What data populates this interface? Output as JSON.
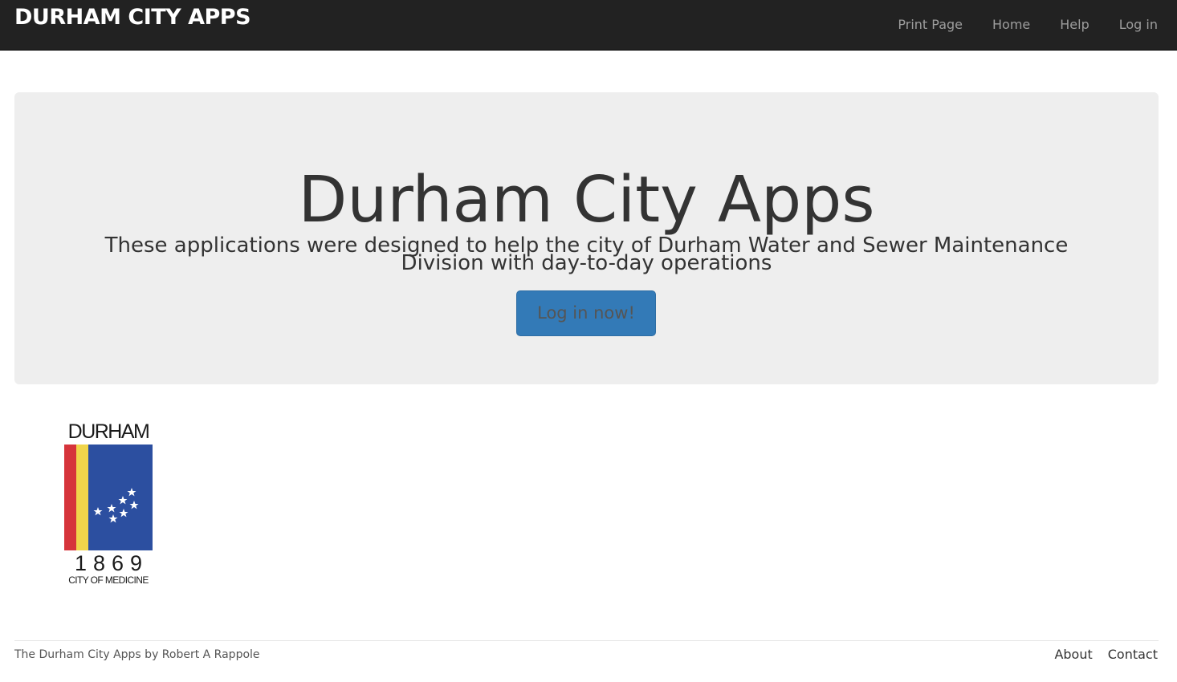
{
  "navbar": {
    "brand": "DURHAM CITY APPS",
    "links": [
      "Print Page",
      "Home",
      "Help",
      "Log in"
    ]
  },
  "jumbotron": {
    "title": "Durham City Apps",
    "lead": "These applications were designed to help the city of Durham Water and Sewer Maintenance Division with day-to-day operations",
    "button_label": "Log in now!"
  },
  "logo": {
    "word": "DURHAM",
    "year": "1869",
    "motto": "CITY OF MEDICINE",
    "colors": {
      "red": "#d6343b",
      "yellow": "#f0d54b",
      "blue": "#2c4fa0"
    }
  },
  "footer": {
    "text": "The Durham City Apps by Robert A Rappole",
    "links": [
      "About",
      "Contact"
    ]
  },
  "colors": {
    "navbar_bg": "#222222",
    "jumbotron_bg": "#eeeeee",
    "button_bg": "#337ab7"
  }
}
